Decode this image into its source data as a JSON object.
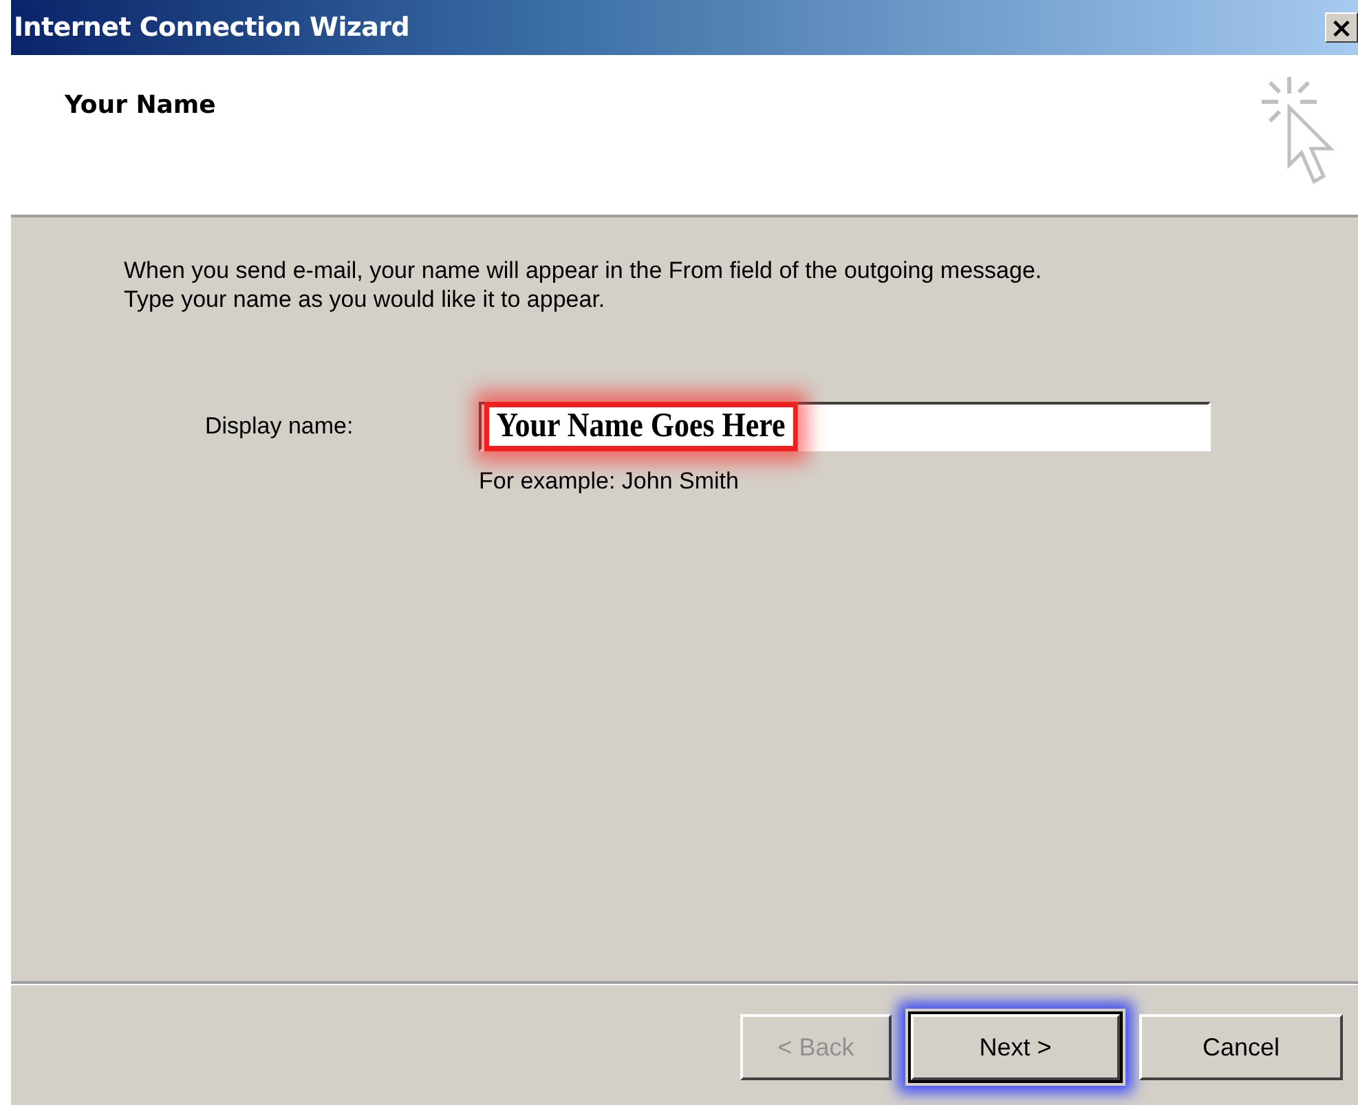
{
  "window": {
    "title": "Internet Connection Wizard",
    "close": "×"
  },
  "header": {
    "title": "Your Name"
  },
  "intro": "When you send e-mail, your name will appear in the From field of the outgoing message.\nType your name as you would like it to appear.",
  "field": {
    "label": "Display name:",
    "value": "Your Name Goes Here",
    "highlighted": true,
    "hint": "For example: John Smith"
  },
  "buttons": [
    {
      "label": "< Back",
      "disabled": true,
      "default": false,
      "highlighted": false
    },
    {
      "label": "Next >",
      "disabled": false,
      "default": true,
      "highlighted": true
    },
    {
      "label": "Cancel",
      "disabled": false,
      "default": false,
      "highlighted": false
    }
  ]
}
